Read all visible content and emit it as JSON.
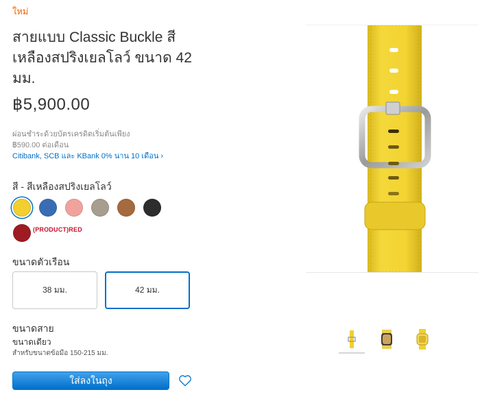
{
  "badge": "ใหม่",
  "product": {
    "title": "สายแบบ Classic Buckle สีเหลืองสปริงเยลโลว์ ขนาด 42 มม.",
    "price": "฿5,900.00"
  },
  "financing": {
    "line1": "ผ่อนชำระด้วยบัตรเครดิตเริ่มต้นเพียง",
    "line2": "฿590.00 ต่อเดือน",
    "link": "Citibank, SCB และ KBank 0% นาน 10 เดือน ›"
  },
  "colors": {
    "label": "สี - สีเหลืองสปริงเยลโลว์",
    "swatches": [
      {
        "name": "spring-yellow",
        "color": "#f2cf2e",
        "selected": true
      },
      {
        "name": "blue",
        "color": "#3a6cb4"
      },
      {
        "name": "pink",
        "color": "#f0a39c"
      },
      {
        "name": "taupe",
        "color": "#a79e8f"
      },
      {
        "name": "saddle-brown",
        "color": "#a56a3e"
      },
      {
        "name": "black",
        "color": "#2d2d2d"
      },
      {
        "name": "product-red",
        "color": "#9e1b22"
      }
    ],
    "product_red_label": "(PRODUCT)RED"
  },
  "case_size": {
    "label": "ขนาดตัวเรือน",
    "options": [
      "38 มม.",
      "42 มม."
    ],
    "selected": "42 มม."
  },
  "band_size": {
    "label": "ขนาดสาย",
    "value": "ขนาดเดียว",
    "note": "สำหรับขนาดข้อมือ 150-215 มม."
  },
  "actions": {
    "add_to_bag": "ใส่ลงในถุง"
  },
  "thumbnails": [
    "band-only",
    "watch-side",
    "watch-front"
  ],
  "theme": {
    "accent": "#0070c9",
    "new": "#f56300"
  }
}
